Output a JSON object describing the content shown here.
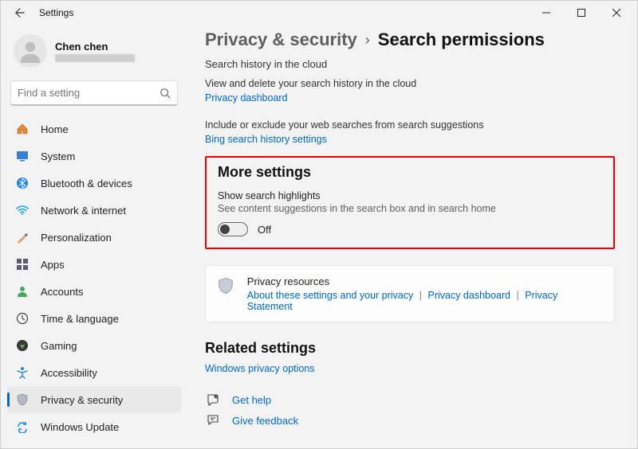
{
  "titlebar": {
    "title": "Settings"
  },
  "account": {
    "name": "Chen chen"
  },
  "search": {
    "placeholder": "Find a setting"
  },
  "nav": {
    "items": [
      {
        "label": "Home"
      },
      {
        "label": "System"
      },
      {
        "label": "Bluetooth & devices"
      },
      {
        "label": "Network & internet"
      },
      {
        "label": "Personalization"
      },
      {
        "label": "Apps"
      },
      {
        "label": "Accounts"
      },
      {
        "label": "Time & language"
      },
      {
        "label": "Gaming"
      },
      {
        "label": "Accessibility"
      },
      {
        "label": "Privacy & security"
      },
      {
        "label": "Windows Update"
      }
    ]
  },
  "breadcrumb": {
    "parent": "Privacy & security",
    "sep": "›",
    "current": "Search permissions"
  },
  "cloud": {
    "title": "Search history in the cloud",
    "desc": "View and delete your search history in the cloud",
    "link": "Privacy dashboard"
  },
  "web": {
    "desc": "Include or exclude your web searches from search suggestions",
    "link": "Bing search history settings"
  },
  "more": {
    "title": "More settings",
    "heading": "Show search highlights",
    "sub": "See content suggestions in the search box and in search home",
    "state": "Off"
  },
  "resources": {
    "title": "Privacy resources",
    "links": {
      "a": "About these settings and your privacy",
      "b": "Privacy dashboard",
      "c": "Privacy Statement"
    },
    "pipe": "|"
  },
  "related": {
    "title": "Related settings",
    "link": "Windows privacy options",
    "help": "Get help",
    "feedback": "Give feedback"
  }
}
